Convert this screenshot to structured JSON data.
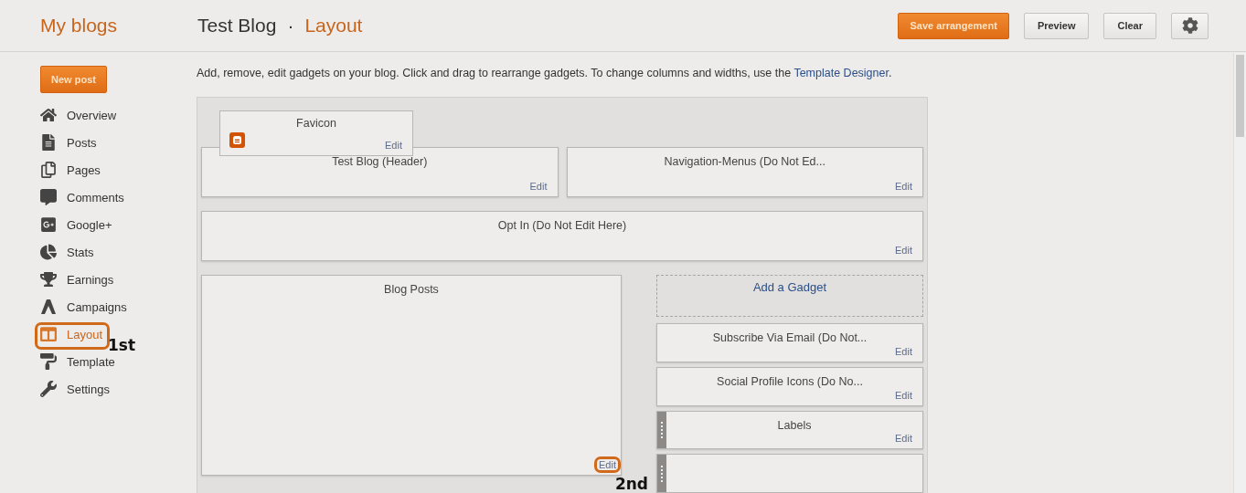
{
  "header": {
    "brand": "My blogs",
    "blog_title": "Test Blog",
    "separator": "·",
    "page_title": "Layout",
    "buttons": [
      {
        "label": "Save arrangement",
        "kind": "primary"
      },
      {
        "label": "Preview",
        "kind": "plain"
      },
      {
        "label": "Clear",
        "kind": "plain"
      },
      {
        "kind": "settings"
      }
    ]
  },
  "sidebar": {
    "new_post": "New post",
    "items": [
      {
        "label": "Overview",
        "selected": false
      },
      {
        "label": "Posts",
        "selected": false
      },
      {
        "label": "Pages",
        "selected": false
      },
      {
        "label": "Comments",
        "selected": false
      },
      {
        "label": "Google+",
        "selected": false
      },
      {
        "label": "Stats",
        "selected": false
      },
      {
        "label": "Earnings",
        "selected": false
      },
      {
        "label": "Campaigns",
        "selected": false
      },
      {
        "label": "Layout",
        "selected": true,
        "annotated": true,
        "annotation": "1st"
      },
      {
        "label": "Template",
        "selected": false
      },
      {
        "label": "Settings",
        "selected": false
      }
    ]
  },
  "intro": {
    "text": "Add, remove, edit gadgets on your blog. Click and drag to rearrange gadgets. To change columns and widths, use the ",
    "link": "Template Designer",
    "end": "."
  },
  "dragging_gadget": {
    "title": "Favicon",
    "edit": "Edit"
  },
  "header_row": [
    {
      "title": "Test Blog (Header)",
      "edit": "Edit"
    },
    {
      "title": "Navigation-Menus (Do Not Ed...",
      "edit": "Edit"
    }
  ],
  "full_row": {
    "title": "Opt In (Do Not Edit Here)",
    "edit": "Edit"
  },
  "main_column": {
    "title": "Blog Posts",
    "edit": "Edit",
    "annotated": true,
    "annotation": "2nd"
  },
  "sidebar_column": {
    "add_gadget": "Add a Gadget",
    "gadgets": [
      {
        "title": "Subscribe Via Email (Do Not...",
        "edit": "Edit",
        "grip": false
      },
      {
        "title": "Social Profile Icons (Do No...",
        "edit": "Edit",
        "grip": false
      },
      {
        "title": "Labels",
        "edit": "Edit",
        "grip": true
      },
      {
        "grip": true
      }
    ]
  }
}
